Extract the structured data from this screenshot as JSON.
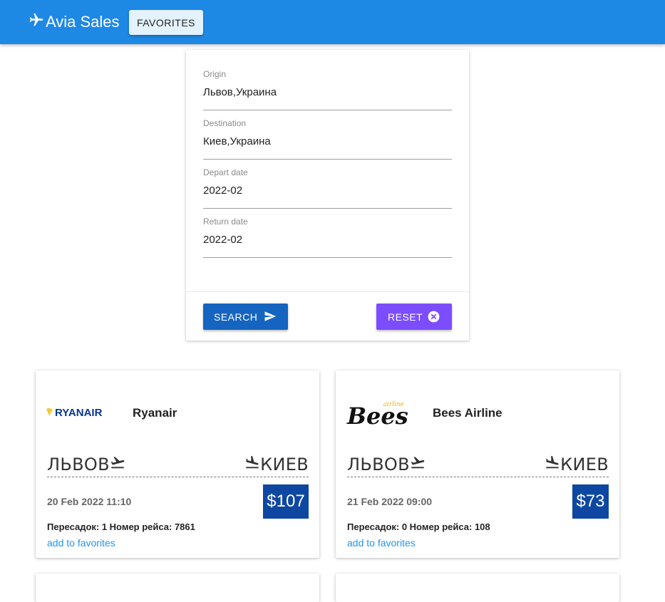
{
  "app": {
    "title": "Avia Sales",
    "icon": "airplane-icon"
  },
  "header": {
    "favorites_label": "FAVORITES"
  },
  "search_form": {
    "fields": [
      {
        "label": "Origin",
        "value": "Львов,Украина"
      },
      {
        "label": "Destination",
        "value": "Киев,Украина"
      },
      {
        "label": "Depart date",
        "value": "2022-02"
      },
      {
        "label": "Return date",
        "value": "2022-02"
      }
    ],
    "search_label": "SEARCH",
    "search_icon": "send-icon",
    "reset_label": "RESET",
    "reset_icon": "close-circle-icon"
  },
  "tickets": [
    {
      "airline": "Ryanair",
      "logo_text": "RYANAIR",
      "from": "ЛЬВОВ",
      "to": "КИЕВ",
      "date": "20 Feb 2022 11:10",
      "price": "$107",
      "meta": "Пересадок: 1 Номер рейса: 7861",
      "favorite_link": "add to favorites"
    },
    {
      "airline": "Bees Airline",
      "logo_text": "Bees",
      "logo_subtext": "airline",
      "from": "ЛЬВОВ",
      "to": "КИЕВ",
      "date": "21 Feb 2022 09:00",
      "price": "$73",
      "meta": "Пересадок: 0 Номер рейса: 108",
      "favorite_link": "add to favorites"
    }
  ],
  "colors": {
    "navbar": "#1e88e5",
    "favorites_button": "#e3f2fd",
    "search_button": "#1565c0",
    "reset_button": "#7c4dff",
    "price_badge": "#0d47a1",
    "link": "#2196f3",
    "ryanair_brand": "#073590",
    "ryanair_harp": "#f1c933",
    "bees_accent": "#f2b705"
  }
}
